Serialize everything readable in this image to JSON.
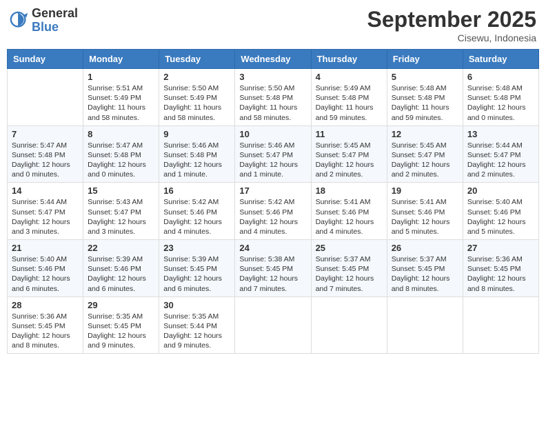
{
  "logo": {
    "general": "General",
    "blue": "Blue"
  },
  "title": "September 2025",
  "subtitle": "Cisewu, Indonesia",
  "days_of_week": [
    "Sunday",
    "Monday",
    "Tuesday",
    "Wednesday",
    "Thursday",
    "Friday",
    "Saturday"
  ],
  "weeks": [
    [
      {
        "num": "",
        "sunrise": "",
        "sunset": "",
        "daylight": ""
      },
      {
        "num": "1",
        "sunrise": "Sunrise: 5:51 AM",
        "sunset": "Sunset: 5:49 PM",
        "daylight": "Daylight: 11 hours and 58 minutes."
      },
      {
        "num": "2",
        "sunrise": "Sunrise: 5:50 AM",
        "sunset": "Sunset: 5:49 PM",
        "daylight": "Daylight: 11 hours and 58 minutes."
      },
      {
        "num": "3",
        "sunrise": "Sunrise: 5:50 AM",
        "sunset": "Sunset: 5:48 PM",
        "daylight": "Daylight: 11 hours and 58 minutes."
      },
      {
        "num": "4",
        "sunrise": "Sunrise: 5:49 AM",
        "sunset": "Sunset: 5:48 PM",
        "daylight": "Daylight: 11 hours and 59 minutes."
      },
      {
        "num": "5",
        "sunrise": "Sunrise: 5:48 AM",
        "sunset": "Sunset: 5:48 PM",
        "daylight": "Daylight: 11 hours and 59 minutes."
      },
      {
        "num": "6",
        "sunrise": "Sunrise: 5:48 AM",
        "sunset": "Sunset: 5:48 PM",
        "daylight": "Daylight: 12 hours and 0 minutes."
      }
    ],
    [
      {
        "num": "7",
        "sunrise": "Sunrise: 5:47 AM",
        "sunset": "Sunset: 5:48 PM",
        "daylight": "Daylight: 12 hours and 0 minutes."
      },
      {
        "num": "8",
        "sunrise": "Sunrise: 5:47 AM",
        "sunset": "Sunset: 5:48 PM",
        "daylight": "Daylight: 12 hours and 0 minutes."
      },
      {
        "num": "9",
        "sunrise": "Sunrise: 5:46 AM",
        "sunset": "Sunset: 5:48 PM",
        "daylight": "Daylight: 12 hours and 1 minute."
      },
      {
        "num": "10",
        "sunrise": "Sunrise: 5:46 AM",
        "sunset": "Sunset: 5:47 PM",
        "daylight": "Daylight: 12 hours and 1 minute."
      },
      {
        "num": "11",
        "sunrise": "Sunrise: 5:45 AM",
        "sunset": "Sunset: 5:47 PM",
        "daylight": "Daylight: 12 hours and 2 minutes."
      },
      {
        "num": "12",
        "sunrise": "Sunrise: 5:45 AM",
        "sunset": "Sunset: 5:47 PM",
        "daylight": "Daylight: 12 hours and 2 minutes."
      },
      {
        "num": "13",
        "sunrise": "Sunrise: 5:44 AM",
        "sunset": "Sunset: 5:47 PM",
        "daylight": "Daylight: 12 hours and 2 minutes."
      }
    ],
    [
      {
        "num": "14",
        "sunrise": "Sunrise: 5:44 AM",
        "sunset": "Sunset: 5:47 PM",
        "daylight": "Daylight: 12 hours and 3 minutes."
      },
      {
        "num": "15",
        "sunrise": "Sunrise: 5:43 AM",
        "sunset": "Sunset: 5:47 PM",
        "daylight": "Daylight: 12 hours and 3 minutes."
      },
      {
        "num": "16",
        "sunrise": "Sunrise: 5:42 AM",
        "sunset": "Sunset: 5:46 PM",
        "daylight": "Daylight: 12 hours and 4 minutes."
      },
      {
        "num": "17",
        "sunrise": "Sunrise: 5:42 AM",
        "sunset": "Sunset: 5:46 PM",
        "daylight": "Daylight: 12 hours and 4 minutes."
      },
      {
        "num": "18",
        "sunrise": "Sunrise: 5:41 AM",
        "sunset": "Sunset: 5:46 PM",
        "daylight": "Daylight: 12 hours and 4 minutes."
      },
      {
        "num": "19",
        "sunrise": "Sunrise: 5:41 AM",
        "sunset": "Sunset: 5:46 PM",
        "daylight": "Daylight: 12 hours and 5 minutes."
      },
      {
        "num": "20",
        "sunrise": "Sunrise: 5:40 AM",
        "sunset": "Sunset: 5:46 PM",
        "daylight": "Daylight: 12 hours and 5 minutes."
      }
    ],
    [
      {
        "num": "21",
        "sunrise": "Sunrise: 5:40 AM",
        "sunset": "Sunset: 5:46 PM",
        "daylight": "Daylight: 12 hours and 6 minutes."
      },
      {
        "num": "22",
        "sunrise": "Sunrise: 5:39 AM",
        "sunset": "Sunset: 5:46 PM",
        "daylight": "Daylight: 12 hours and 6 minutes."
      },
      {
        "num": "23",
        "sunrise": "Sunrise: 5:39 AM",
        "sunset": "Sunset: 5:45 PM",
        "daylight": "Daylight: 12 hours and 6 minutes."
      },
      {
        "num": "24",
        "sunrise": "Sunrise: 5:38 AM",
        "sunset": "Sunset: 5:45 PM",
        "daylight": "Daylight: 12 hours and 7 minutes."
      },
      {
        "num": "25",
        "sunrise": "Sunrise: 5:37 AM",
        "sunset": "Sunset: 5:45 PM",
        "daylight": "Daylight: 12 hours and 7 minutes."
      },
      {
        "num": "26",
        "sunrise": "Sunrise: 5:37 AM",
        "sunset": "Sunset: 5:45 PM",
        "daylight": "Daylight: 12 hours and 8 minutes."
      },
      {
        "num": "27",
        "sunrise": "Sunrise: 5:36 AM",
        "sunset": "Sunset: 5:45 PM",
        "daylight": "Daylight: 12 hours and 8 minutes."
      }
    ],
    [
      {
        "num": "28",
        "sunrise": "Sunrise: 5:36 AM",
        "sunset": "Sunset: 5:45 PM",
        "daylight": "Daylight: 12 hours and 8 minutes."
      },
      {
        "num": "29",
        "sunrise": "Sunrise: 5:35 AM",
        "sunset": "Sunset: 5:45 PM",
        "daylight": "Daylight: 12 hours and 9 minutes."
      },
      {
        "num": "30",
        "sunrise": "Sunrise: 5:35 AM",
        "sunset": "Sunset: 5:44 PM",
        "daylight": "Daylight: 12 hours and 9 minutes."
      },
      {
        "num": "",
        "sunrise": "",
        "sunset": "",
        "daylight": ""
      },
      {
        "num": "",
        "sunrise": "",
        "sunset": "",
        "daylight": ""
      },
      {
        "num": "",
        "sunrise": "",
        "sunset": "",
        "daylight": ""
      },
      {
        "num": "",
        "sunrise": "",
        "sunset": "",
        "daylight": ""
      }
    ]
  ]
}
